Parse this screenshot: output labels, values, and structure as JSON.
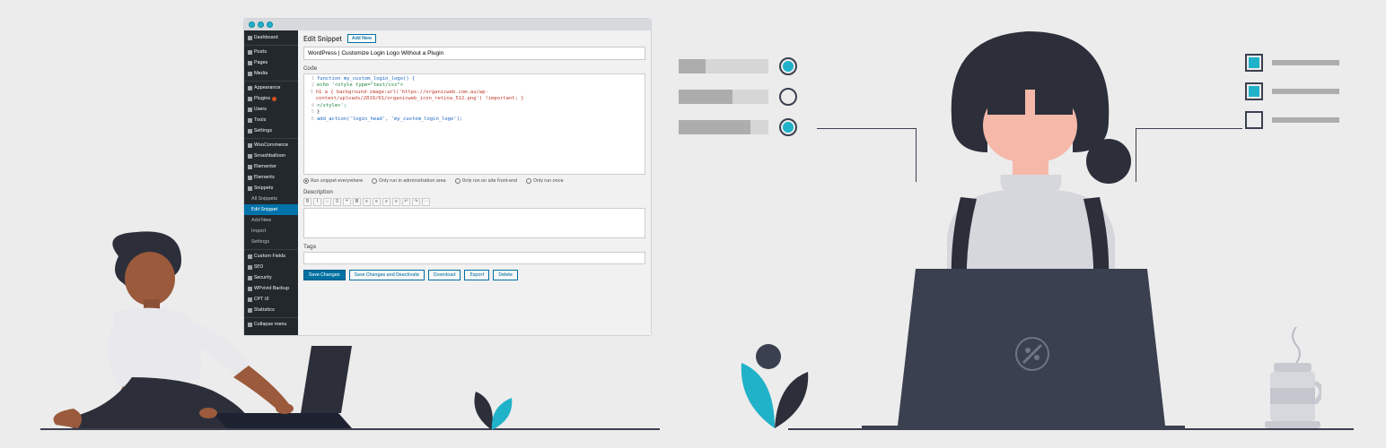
{
  "wp": {
    "heading": "Edit Snippet",
    "add_new": "Add New",
    "title_value": "WordPress | Customize Login Logo Without a Plugin",
    "labels": {
      "code": "Code",
      "description": "Description",
      "tags": "Tags"
    },
    "code_lines": [
      {
        "n": "1",
        "cls": "c-blue",
        "t": "function my_custom_login_logo() {"
      },
      {
        "n": "2",
        "cls": "c-green",
        "t": "  echo '<style type=\"text/css\">"
      },
      {
        "n": "3",
        "cls": "c-red",
        "t": "  h1 a { background-image:url('https://organicweb.com.au/wp-content/uploads/2019/01/organicweb_icon_retina_512.png') !important; }"
      },
      {
        "n": "4",
        "cls": "c-green",
        "t": "  </style>';"
      },
      {
        "n": "5",
        "cls": "c-plain",
        "t": "}"
      },
      {
        "n": "6",
        "cls": "c-blue",
        "t": "add_action('login_head', 'my_custom_login_logo');"
      }
    ],
    "radios": [
      {
        "label": "Run snippet everywhere",
        "on": true
      },
      {
        "label": "Only run in administration area",
        "on": false
      },
      {
        "label": "Only run on site front-end",
        "on": false
      },
      {
        "label": "Only run once",
        "on": false
      }
    ],
    "actions": {
      "save": "Save Changes",
      "save_deactivate": "Save Changes and Deactivate",
      "download": "Download",
      "export": "Export",
      "delete": "Delete"
    },
    "sidebar": [
      {
        "label": "Dashboard",
        "type": "top"
      },
      {
        "label": "Posts",
        "type": "sep"
      },
      {
        "label": "Pages",
        "type": "item"
      },
      {
        "label": "Media",
        "type": "item"
      },
      {
        "label": "Appearance",
        "type": "sep"
      },
      {
        "label": "Plugins",
        "type": "item",
        "badge": true
      },
      {
        "label": "Users",
        "type": "item"
      },
      {
        "label": "Tools",
        "type": "item"
      },
      {
        "label": "Settings",
        "type": "item"
      },
      {
        "label": "WooCommerce",
        "type": "sep"
      },
      {
        "label": "Smashballoon",
        "type": "item"
      },
      {
        "label": "Elementor",
        "type": "item"
      },
      {
        "label": "Elements",
        "type": "item"
      },
      {
        "label": "Snippets",
        "type": "item"
      },
      {
        "label": "All Snippets",
        "type": "sub"
      },
      {
        "label": "Edit Snippet",
        "type": "sub",
        "active": true
      },
      {
        "label": "Add New",
        "type": "sub"
      },
      {
        "label": "Import",
        "type": "sub"
      },
      {
        "label": "Settings",
        "type": "sub"
      },
      {
        "label": "Custom Fields",
        "type": "sep"
      },
      {
        "label": "SEO",
        "type": "item"
      },
      {
        "label": "Security",
        "type": "item"
      },
      {
        "label": "WPvivid Backup",
        "type": "item"
      },
      {
        "label": "CPT UI",
        "type": "item"
      },
      {
        "label": "Statistics",
        "type": "item"
      },
      {
        "label": "Collapse menu",
        "type": "sep"
      }
    ]
  },
  "sliders": [
    {
      "fill": 30,
      "on": true
    },
    {
      "fill": 60,
      "on": false
    },
    {
      "fill": 80,
      "on": true
    }
  ],
  "checklist": [
    {
      "on": true
    },
    {
      "on": true
    },
    {
      "on": false
    }
  ],
  "colors": {
    "accent": "#20b2c9",
    "dark": "#3b4050",
    "bg": "#ececec"
  }
}
